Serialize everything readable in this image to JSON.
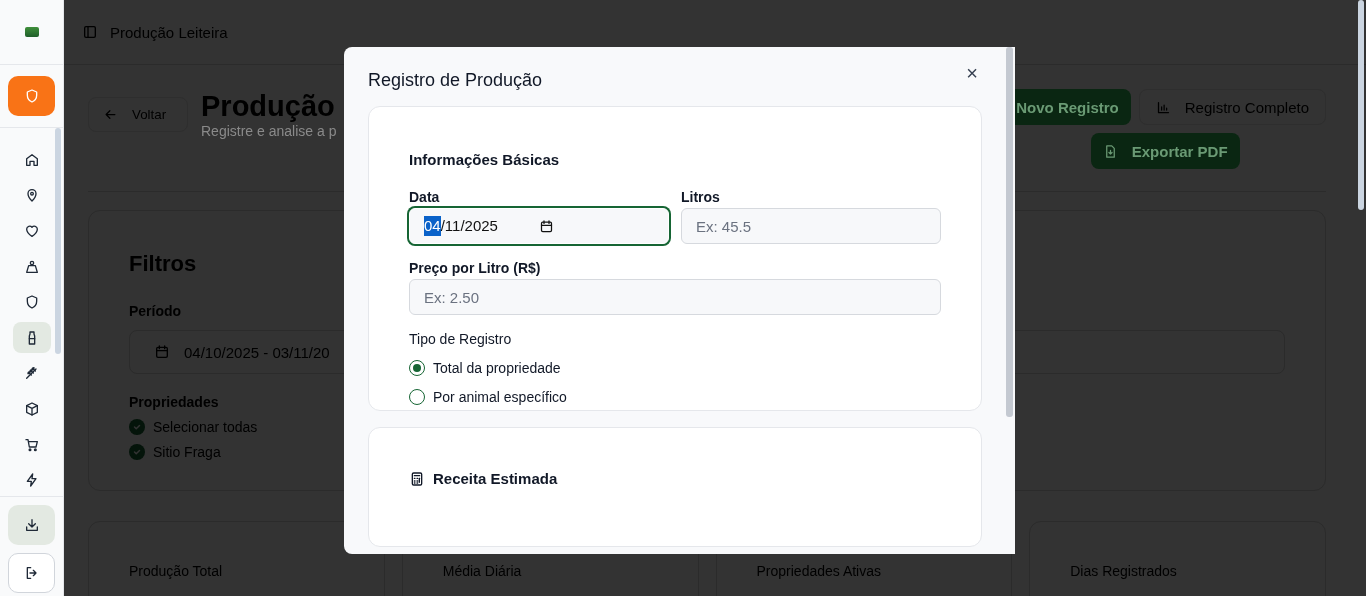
{
  "sidebar": {
    "top_button": {
      "kind": "shield"
    },
    "items": [
      {
        "kind": "home",
        "selected": false
      },
      {
        "kind": "pin",
        "selected": false
      },
      {
        "kind": "heart",
        "selected": false
      },
      {
        "kind": "weight",
        "selected": false
      },
      {
        "kind": "shield",
        "selected": false
      },
      {
        "kind": "bottle",
        "selected": true
      },
      {
        "kind": "wheat",
        "selected": false
      },
      {
        "kind": "box",
        "selected": false
      },
      {
        "kind": "cart",
        "selected": false
      },
      {
        "kind": "zap",
        "selected": false
      }
    ],
    "bottom_items": [
      {
        "kind": "download",
        "selected": true
      },
      {
        "kind": "logout",
        "selected": false
      }
    ]
  },
  "header": {
    "title": "Produção Leiteira"
  },
  "page": {
    "back_button": "Voltar",
    "title": "Produção",
    "subtitle": "Registre e analise a p",
    "actions": [
      {
        "label": "Novo Registro",
        "kind": "primary"
      },
      {
        "label": "Registro Completo",
        "kind": "outline"
      },
      {
        "label": "Exportar PDF",
        "kind": "primary"
      }
    ],
    "filters": {
      "title": "Filtros",
      "period_label": "Período",
      "period_value": "04/10/2025 - 03/11/20",
      "properties_label": "Propriedades",
      "properties": [
        {
          "label": "Selecionar todas",
          "checked": true
        },
        {
          "label": "Sitio Fraga",
          "checked": true
        }
      ]
    },
    "stats": [
      {
        "label": "Produção Total"
      },
      {
        "label": "Média Diária"
      },
      {
        "label": "Propriedades Ativas"
      },
      {
        "label": "Dias Registrados"
      }
    ]
  },
  "modal": {
    "title": "Registro de Produção",
    "close": "×",
    "basic": {
      "title": "Informações Básicas",
      "date": {
        "label": "Data",
        "segments": [
          {
            "text": "04",
            "selected": true
          },
          {
            "text": "/11/2025",
            "selected": false
          }
        ]
      },
      "liters": {
        "label": "Litros",
        "placeholder": "Ex: 45.5"
      },
      "price": {
        "label": "Preço por Litro (R$)",
        "placeholder": "Ex: 2.50"
      },
      "type_label": "Tipo de Registro",
      "types": [
        {
          "label": "Total da propriedade",
          "selected": true
        },
        {
          "label": "Por animal específico",
          "selected": false
        }
      ]
    },
    "revenue": {
      "title": "Receita Estimada"
    }
  }
}
